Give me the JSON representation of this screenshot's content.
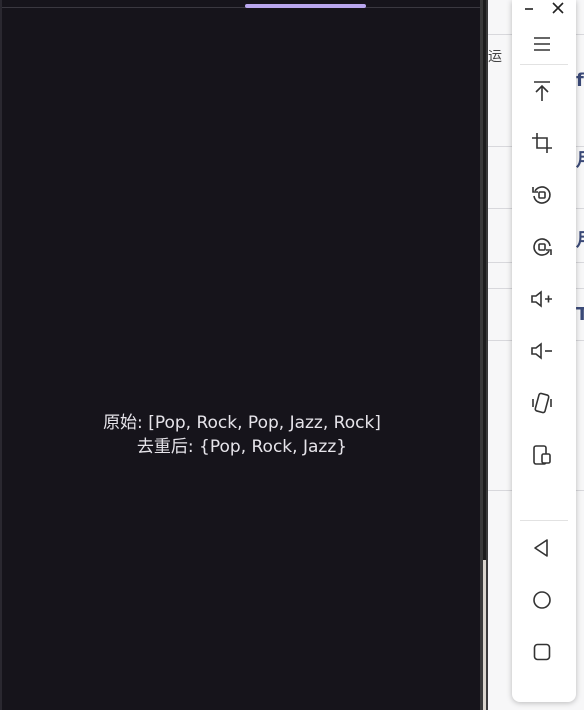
{
  "console": {
    "line1": "原始: [Pop, Rock, Pop, Jazz, Rock]",
    "line2": "去重后: {Pop, Rock, Jazz}"
  },
  "ide_fragments": {
    "tab_char": "运",
    "chars": [
      "f",
      "月",
      "月",
      "T"
    ]
  },
  "toolbar": {
    "icons": [
      "minimize-icon",
      "close-icon",
      "menu-icon",
      "pin-top-icon",
      "crop-icon",
      "rotate-left-icon",
      "rotate-right-icon",
      "volume-up-icon",
      "volume-down-icon",
      "shake-icon",
      "screenshot-device-icon",
      "back-icon",
      "home-icon",
      "overview-icon"
    ]
  },
  "colors": {
    "screen_bg": "#16141b",
    "indicator": "#b9a6ee",
    "text": "#e6e4ea"
  }
}
